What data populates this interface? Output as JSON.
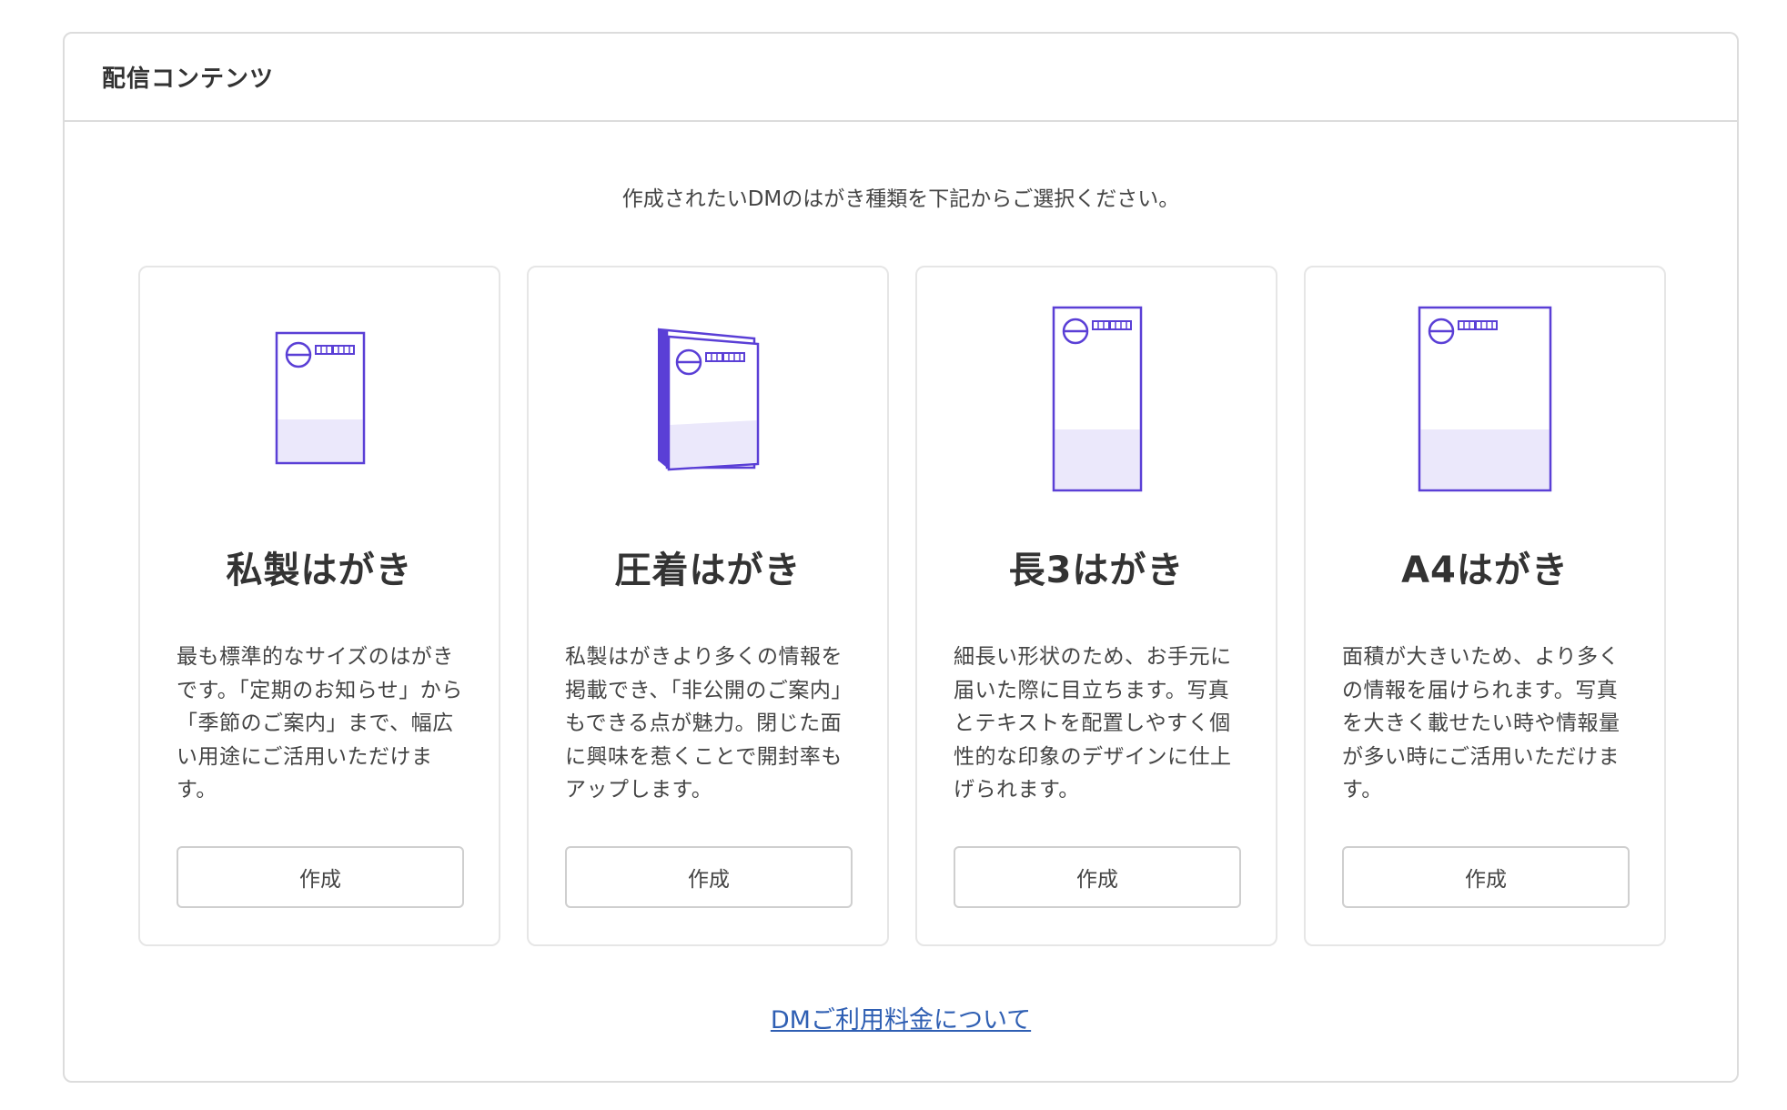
{
  "section": {
    "title": "配信コンテンツ",
    "instruction": "作成されたいDMのはがき種類を下記からご選択ください。"
  },
  "colors": {
    "accent": "#5a3fd6",
    "accent_fill": "#ebe8fb",
    "link": "#2f5fb3",
    "border": "#dcdcdc"
  },
  "cards": [
    {
      "icon": "postcard-icon",
      "title": "私製はがき",
      "description": "最も標準的なサイズのはがきです。「定期のお知らせ」から「季節のご案内」まで、幅広い用途にご活用いただけます。",
      "button_label": "作成"
    },
    {
      "icon": "sealed-postcard-icon",
      "title": "圧着はがき",
      "description": "私製はがきより多くの情報を掲載でき、「非公開のご案内」もできる点が魅力。閉じた面に興味を惹くことで開封率もアップします。",
      "button_label": "作成"
    },
    {
      "icon": "long3-postcard-icon",
      "title": "長3はがき",
      "description": "細長い形状のため、お手元に届いた際に目立ちます。写真とテキストを配置しやすく個性的な印象のデザインに仕上げられます。",
      "button_label": "作成"
    },
    {
      "icon": "a4-postcard-icon",
      "title": "A4はがき",
      "description": "面積が大きいため、より多くの情報を届けられます。写真を大きく載せたい時や情報量が多い時にご活用いただけます。",
      "button_label": "作成"
    }
  ],
  "footer": {
    "pricing_link": "DMご利用料金について"
  }
}
